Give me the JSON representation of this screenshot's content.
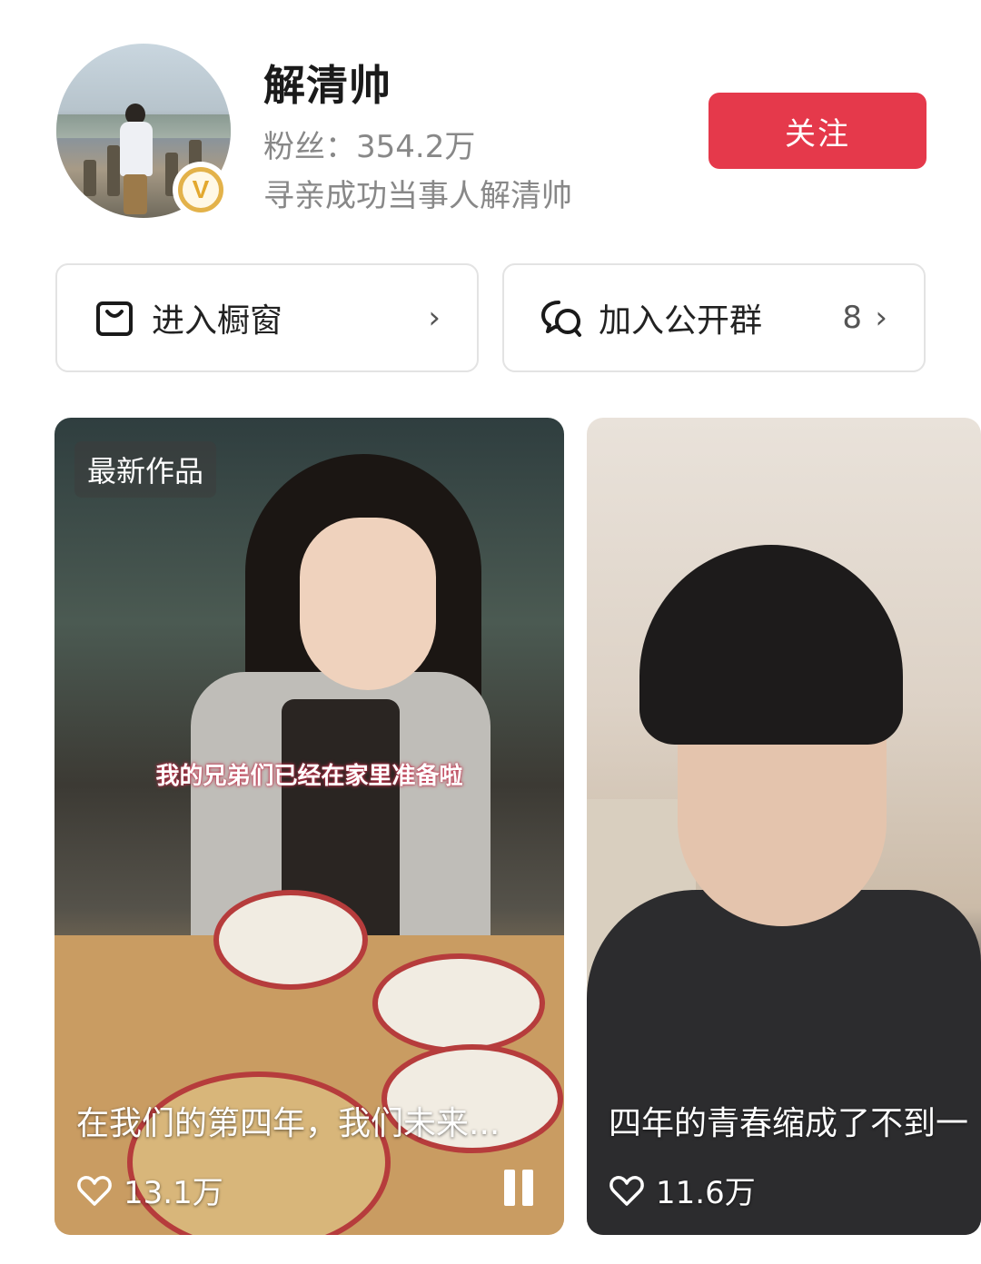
{
  "profile": {
    "name": "解清帅",
    "fans": "粉丝：354.2万",
    "bio": "寻亲成功当事人解清帅",
    "follow_label": "关注",
    "verified_badge": "V"
  },
  "actions": {
    "shop": {
      "label": "进入橱窗",
      "icon": "bag-icon",
      "chevron": "›"
    },
    "group": {
      "label": "加入公开群",
      "icon": "chat-bubbles-icon",
      "count": "8",
      "chevron": "›"
    }
  },
  "videos": [
    {
      "badge": "最新作品",
      "subtitle": "我的兄弟们已经在家里准备啦",
      "title": "在我们的第四年，我们未来...",
      "likes": "13.1万",
      "playing": true
    },
    {
      "title": "四年的青春缩成了不到一",
      "likes": "11.6万"
    }
  ],
  "colors": {
    "accent": "#e5394b",
    "badge": "#e3b24a"
  }
}
